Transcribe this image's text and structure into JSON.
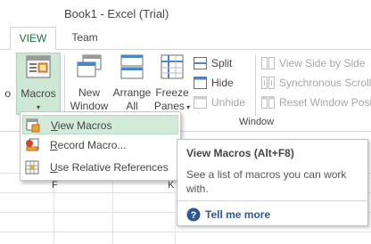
{
  "window": {
    "title": "Book1 - Excel (Trial)"
  },
  "tabs": [
    {
      "label": "VIEW",
      "active": true
    },
    {
      "label": "Team",
      "active": false
    }
  ],
  "ribbon": {
    "zoom_fragment": "o",
    "macros": {
      "label": "Macros",
      "has_dropdown": true
    },
    "new_window": {
      "line1": "New",
      "line2": "Window"
    },
    "arrange_all": {
      "line1": "Arrange",
      "line2": "All"
    },
    "freeze_panes": {
      "line1": "Freeze",
      "line2": "Panes"
    },
    "split": "Split",
    "hide": "Hide",
    "unhide": "Unhide",
    "view_side_by_side": "View Side by Side",
    "synchronous_scrolling": "Synchronous Scrolli",
    "reset_window_position": "Reset Window Posi",
    "group_label": "Window"
  },
  "menu": {
    "items": [
      {
        "label": "View Macros",
        "underline": "V",
        "rest": "iew Macros",
        "highlighted": true
      },
      {
        "label": "Record Macro...",
        "underline": "R",
        "rest": "ecord Macro...",
        "highlighted": false
      },
      {
        "label": "Use Relative References",
        "underline": "U",
        "rest": "se Relative References",
        "highlighted": false
      }
    ]
  },
  "tooltip": {
    "title": "View Macros (Alt+F8)",
    "body": "See a list of macros you can work with.",
    "help": "Tell me more"
  },
  "sheet": {
    "partial_headers": [
      "F",
      "K"
    ]
  },
  "colors": {
    "accent": "#217346",
    "highlight": "#d3eadb",
    "link": "#2b579a",
    "disabled": "#a6a6a6"
  }
}
